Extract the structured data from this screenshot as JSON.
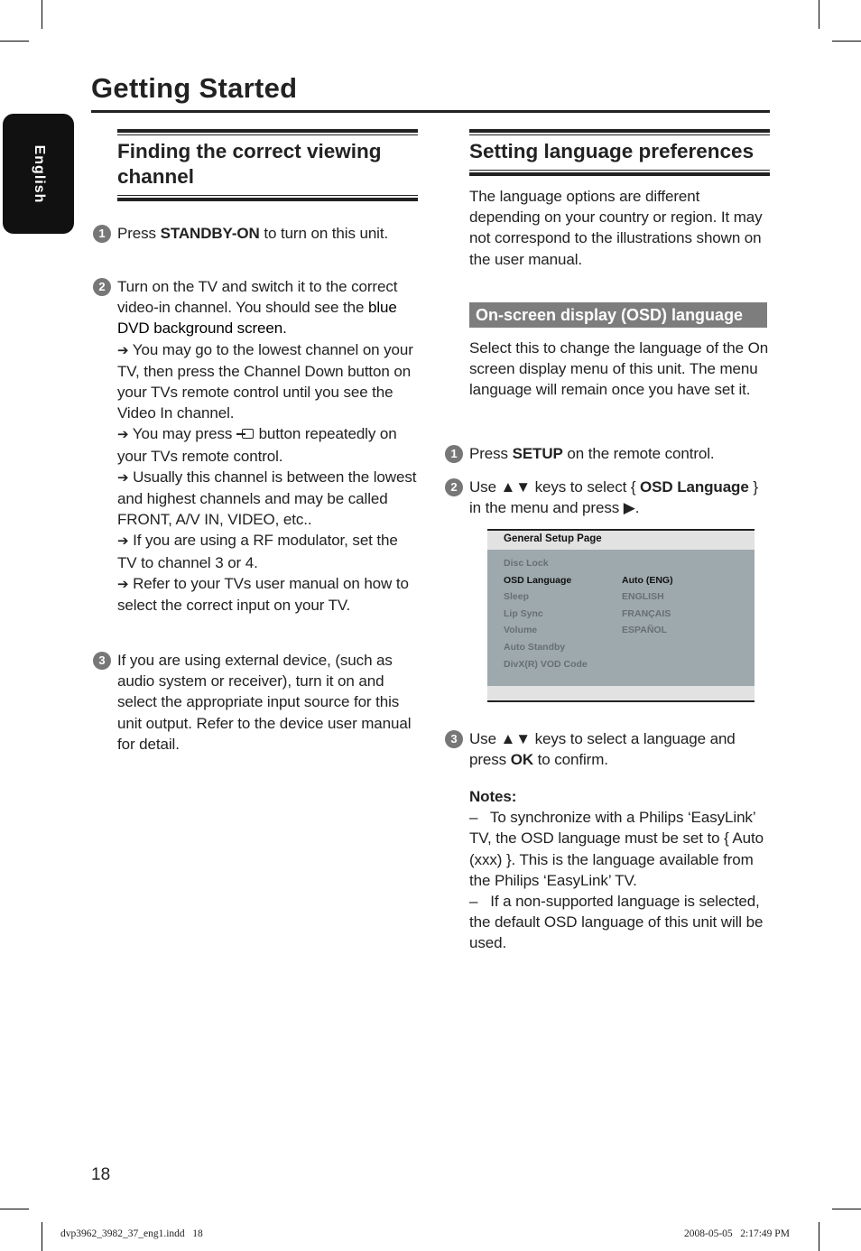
{
  "page_title": "Getting Started",
  "side_tab": "English",
  "left": {
    "heading": "Finding the correct viewing channel",
    "steps": [
      {
        "num": "1",
        "pre": "Press ",
        "bold": "STANDBY-ON",
        "post": " to turn on this unit."
      },
      {
        "num": "2",
        "text": "Turn on the TV and switch it to the correct video-in channel. You should see the ",
        "emph": "blue DVD background screen.",
        "bullets": [
          "You may go to the lowest channel on your TV, then press the Channel Down button on your TVs remote control until you see the Video In channel.",
          {
            "pre": "You may press ",
            "post": " button repeatedly on your TVs remote control."
          },
          "Usually this channel is between the lowest and highest channels and may be called FRONT, A/V IN, VIDEO, etc..",
          "If you are using a RF modulator, set the TV to channel 3 or 4.",
          "Refer to your TVs user manual on how to select the correct input on your TV."
        ]
      },
      {
        "num": "3",
        "text": "If you are using external device, (such as audio system or receiver), turn it on and select the appropriate input source for this unit output. Refer to the device user manual for detail."
      }
    ]
  },
  "right": {
    "heading": "Setting language preferences",
    "intro": "The language options are different depending on your country or region. It may not correspond to the illustrations shown on the user manual.",
    "subheading": "On-screen display (OSD) language",
    "sub_intro": "Select this to change the language of the On screen display menu of this unit. The menu language will remain once you have set it.",
    "steps": [
      {
        "num": "1",
        "pre": "Press ",
        "bold": "SETUP",
        "post": " on the remote control."
      },
      {
        "num": "2",
        "pre": "Use ▲▼ keys to select { ",
        "bold": "OSD Language",
        "post": " } in the menu and press ▶."
      },
      {
        "num": "3",
        "pre": "Use ▲▼ keys to select a language and press ",
        "bold": "OK",
        "post": " to confirm."
      }
    ],
    "menu": {
      "title": "General Setup Page",
      "items": [
        "Disc Lock",
        "OSD Language",
        "Sleep",
        "Lip Sync",
        "Volume",
        "Auto Standby",
        "DivX(R) VOD Code"
      ],
      "selected_item": "OSD Language",
      "options": [
        "Auto (ENG)",
        "ENGLISH",
        "FRANÇAIS",
        "ESPAÑOL"
      ],
      "selected_option": "Auto (ENG)"
    },
    "notes_title": "Notes:",
    "notes": [
      "To synchronize with a Philips ‘EasyLink’ TV, the OSD language must be set to { Auto (xxx) }. This is the language available from the Philips ‘EasyLink’ TV.",
      "If a non-supported language is selected, the default OSD language of this unit will be used."
    ]
  },
  "page_number": "18",
  "footer": {
    "file": "dvp3962_3982_37_eng1.indd   18",
    "timestamp": "2008-05-05   2:17:49 PM"
  }
}
